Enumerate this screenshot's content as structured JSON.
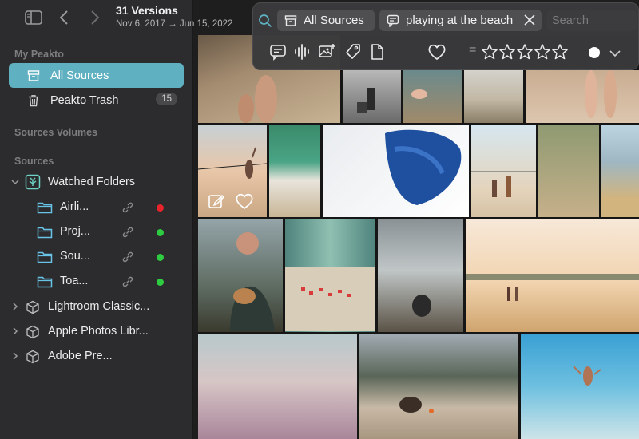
{
  "header": {
    "title": "31 Versions",
    "date_range": "Nov 6, 2017 → Jun 15, 2022"
  },
  "sidebar": {
    "section_my": "My Peakto",
    "all_sources": "All Sources",
    "trash": "Peakto Trash",
    "trash_count": "15",
    "section_volumes": "Sources Volumes",
    "section_sources": "Sources",
    "watched_folders": "Watched Folders",
    "folders": [
      {
        "label": "Airli...",
        "status_color": "#e5242b"
      },
      {
        "label": "Proj...",
        "status_color": "#2ecc40"
      },
      {
        "label": "Sou...",
        "status_color": "#2ecc40"
      },
      {
        "label": "Toa...",
        "status_color": "#2ecc40"
      }
    ],
    "catalogs": [
      {
        "label": "Lightroom Classic..."
      },
      {
        "label": "Apple Photos Libr..."
      },
      {
        "label": "Adobe Pre..."
      }
    ]
  },
  "search": {
    "token_sources": "All Sources",
    "token_query": "playing at the beach",
    "placeholder": "Search",
    "rating_operator": "="
  },
  "colors": {
    "accent": "#5fb0c0",
    "sidebar_bg": "#2c2c2e",
    "grid_bg": "#161616"
  }
}
